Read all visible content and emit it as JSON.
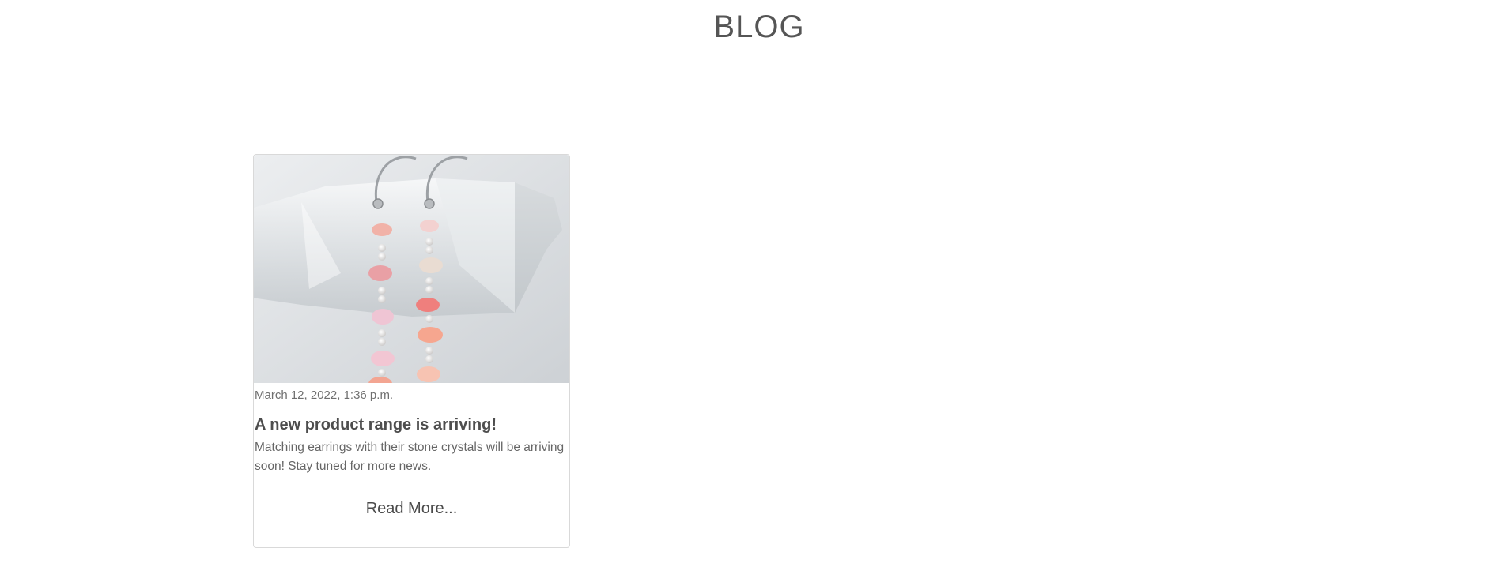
{
  "page": {
    "title": "BLOG"
  },
  "posts": [
    {
      "image_alt": "Pink stone chip earrings hanging on a clear quartz crystal",
      "date": "March 12, 2022, 1:36 p.m.",
      "title": "A new product range is arriving!",
      "excerpt": "Matching earrings with their stone crystals will be arriving soon! Stay tuned for more news.",
      "read_more_label": "Read More..."
    }
  ],
  "colors": {
    "text": "#555555",
    "card_border": "#d9d9d9",
    "muted": "#6f6f6f"
  }
}
